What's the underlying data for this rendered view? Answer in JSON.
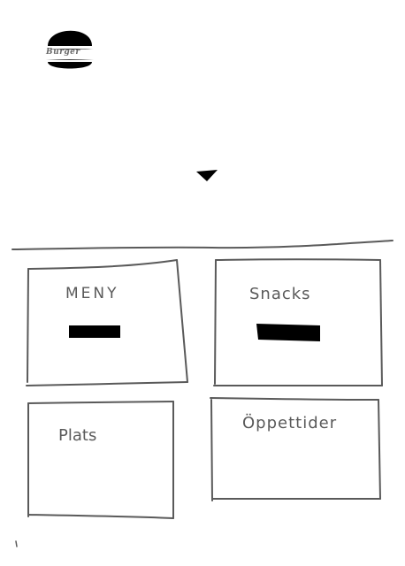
{
  "logo": {
    "text": "Burger",
    "icon": "burger-icon"
  },
  "hero": {
    "scroll_icon": "chevron-down-icon"
  },
  "tiles": [
    {
      "id": "meny",
      "label": "MENY",
      "has_button": true
    },
    {
      "id": "snacks",
      "label": "Snacks",
      "has_button": true
    },
    {
      "id": "plats",
      "label": "Plats",
      "has_button": false
    },
    {
      "id": "oppettider",
      "label": "Öppettider",
      "has_button": false
    }
  ],
  "colors": {
    "stroke": "#5a5a5a",
    "background": "#ffffff"
  }
}
